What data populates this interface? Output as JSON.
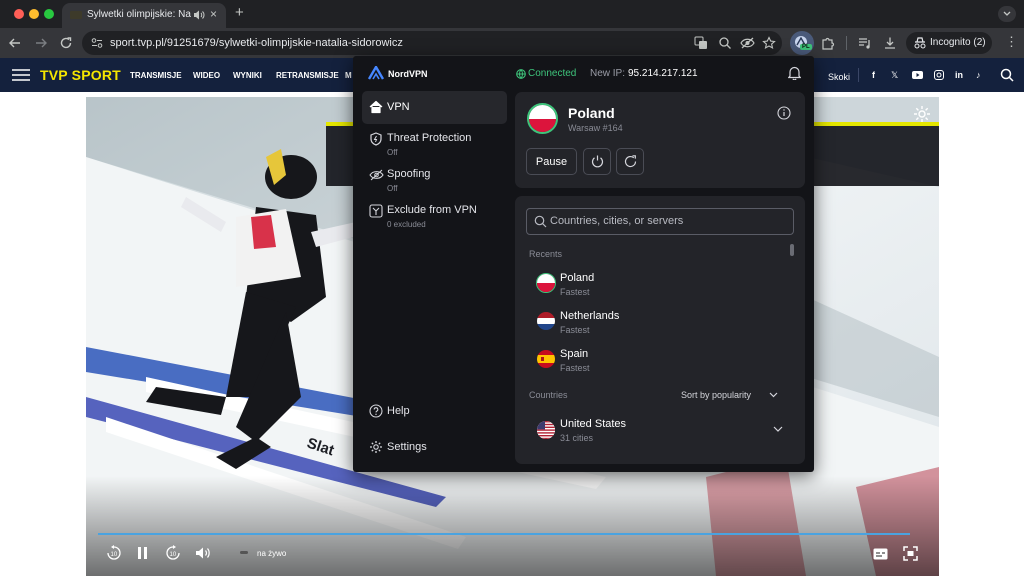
{
  "browser": {
    "tab_title": "Sylwetki olimpijskie: Natalia Sidorowicz",
    "url": "sport.tvp.pl/91251679/sylwetki-olimpijskie-natalia-sidorowicz",
    "incognito_label": "Incognito (2)",
    "extension_badge": "PL"
  },
  "site": {
    "logo": "TVP SPORT",
    "nav": [
      "TRANSMISJE",
      "WIDEO",
      "WYNIKI",
      "RETRANSMISJE",
      "M"
    ],
    "right_link": "Skoki",
    "social_icons": [
      "facebook-icon",
      "x-icon",
      "youtube-icon",
      "instagram-icon",
      "linkedin-icon",
      "tiktok-icon"
    ]
  },
  "video": {
    "live_label": "na żywo",
    "board_text": "Slat",
    "progress_fraction": 1.0
  },
  "nordvpn": {
    "brand": "NordVPN",
    "status": "Connected",
    "ip_label": "New IP:",
    "ip": "95.214.217.121",
    "menu": [
      {
        "title": "VPN",
        "sub": ""
      },
      {
        "title": "Threat Protection",
        "sub": "Off"
      },
      {
        "title": "Spoofing",
        "sub": "Off"
      },
      {
        "title": "Exclude from VPN",
        "sub": "0 excluded"
      }
    ],
    "help": "Help",
    "settings": "Settings",
    "server": {
      "country": "Poland",
      "location": "Warsaw #164"
    },
    "pause_label": "Pause",
    "search_placeholder": "Countries, cities, or servers",
    "recents_label": "Recents",
    "recents": [
      {
        "name": "Poland",
        "sub": "Fastest"
      },
      {
        "name": "Netherlands",
        "sub": "Fastest"
      },
      {
        "name": "Spain",
        "sub": "Fastest"
      }
    ],
    "countries_label": "Countries",
    "sort_label": "Sort by popularity",
    "countries": [
      {
        "name": "United States",
        "sub": "31 cities"
      }
    ],
    "colors": {
      "accent_green": "#3ec47b",
      "panel": "#131418",
      "card": "#232429"
    }
  }
}
